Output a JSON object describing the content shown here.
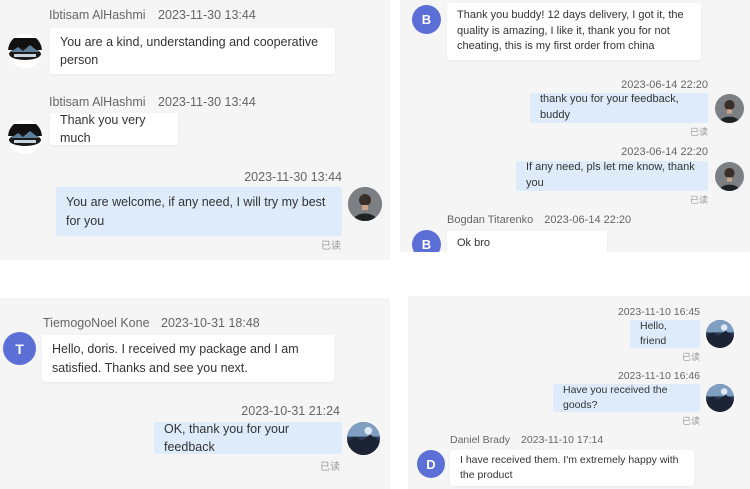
{
  "colors": {
    "letter_avatar": "#5b6fd6",
    "outgoing_bubble": "#ddebfb",
    "incoming_bubble": "#ffffff",
    "panel_bg": "#f5f5f6"
  },
  "panel1": {
    "m1": {
      "sender": "Ibtisam AlHashmi",
      "time": "2023-11-30 13:44",
      "text": "You are a kind, understanding and cooperative person"
    },
    "m2": {
      "sender": "Ibtisam AlHashmi",
      "time": "2023-11-30 13:44",
      "text": "Thank you very much"
    },
    "m3": {
      "time": "2023-11-30 13:44",
      "text": "You are welcome, if any need, I will try my best for you",
      "status": "已读"
    }
  },
  "panel2": {
    "m1": {
      "avatar": "B",
      "text": "Thank you buddy! 12 days delivery, I got it, the quality is amazing, I like it, thank you for not cheating, this is my first order from china"
    },
    "m2": {
      "time": "2023-06-14 22:20",
      "text": "thank you for your feedback, buddy",
      "status": "已读"
    },
    "m3": {
      "time": "2023-06-14 22:20",
      "text": "If any need, pls let me know, thank you",
      "status": "已读"
    },
    "m4": {
      "avatar": "B",
      "sender": "Bogdan Titarenko",
      "time": "2023-06-14 22:20",
      "text": "Ok bro"
    }
  },
  "panel3": {
    "m1": {
      "avatar": "T",
      "sender": "TiemogoNoel Kone",
      "time": "2023-10-31 18:48",
      "text": "Hello, doris. I received my package and I am satisfied. Thanks and see you next."
    },
    "m2": {
      "time": "2023-10-31 21:24",
      "text": "OK, thank you for your feedback",
      "status": "已读"
    }
  },
  "panel4": {
    "m1": {
      "time": "2023-11-10 16:45",
      "text": "Hello, friend",
      "status": "已读"
    },
    "m2": {
      "time": "2023-11-10 16:46",
      "text": "Have you received the goods?",
      "status": "已读"
    },
    "m3": {
      "avatar": "D",
      "sender": "Daniel Brady",
      "time": "2023-11-10 17:14",
      "text": "I have received them. I'm extremely happy with the product"
    }
  }
}
